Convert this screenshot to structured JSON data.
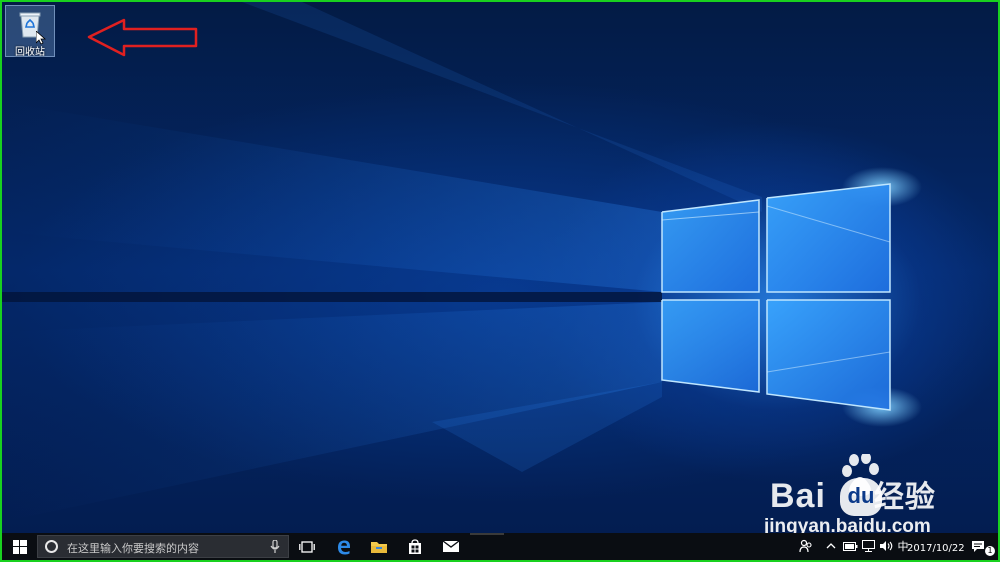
{
  "desktop": {
    "icons": [
      {
        "label": "回收站",
        "icon": "recycle-bin-icon"
      }
    ],
    "annotation": {
      "icon": "red-arrow-icon",
      "color": "#e02020"
    }
  },
  "taskbar": {
    "search": {
      "placeholder": "在这里输入你要搜索的内容"
    },
    "apps": [
      {
        "icon": "task-view-icon"
      },
      {
        "icon": "edge-icon"
      },
      {
        "icon": "file-explorer-icon"
      },
      {
        "icon": "store-icon"
      },
      {
        "icon": "mail-icon"
      }
    ],
    "tray": {
      "ime_label": "中",
      "date": "2017/10/22",
      "notification_count": "1"
    }
  },
  "watermark": {
    "brand_latin": "Bai",
    "brand_cn": "经验",
    "url": "jingyan.baidu.com"
  },
  "colors": {
    "frame_border": "#19d11f",
    "taskbar": "#0a0d12",
    "accent": "#1e90ff"
  }
}
